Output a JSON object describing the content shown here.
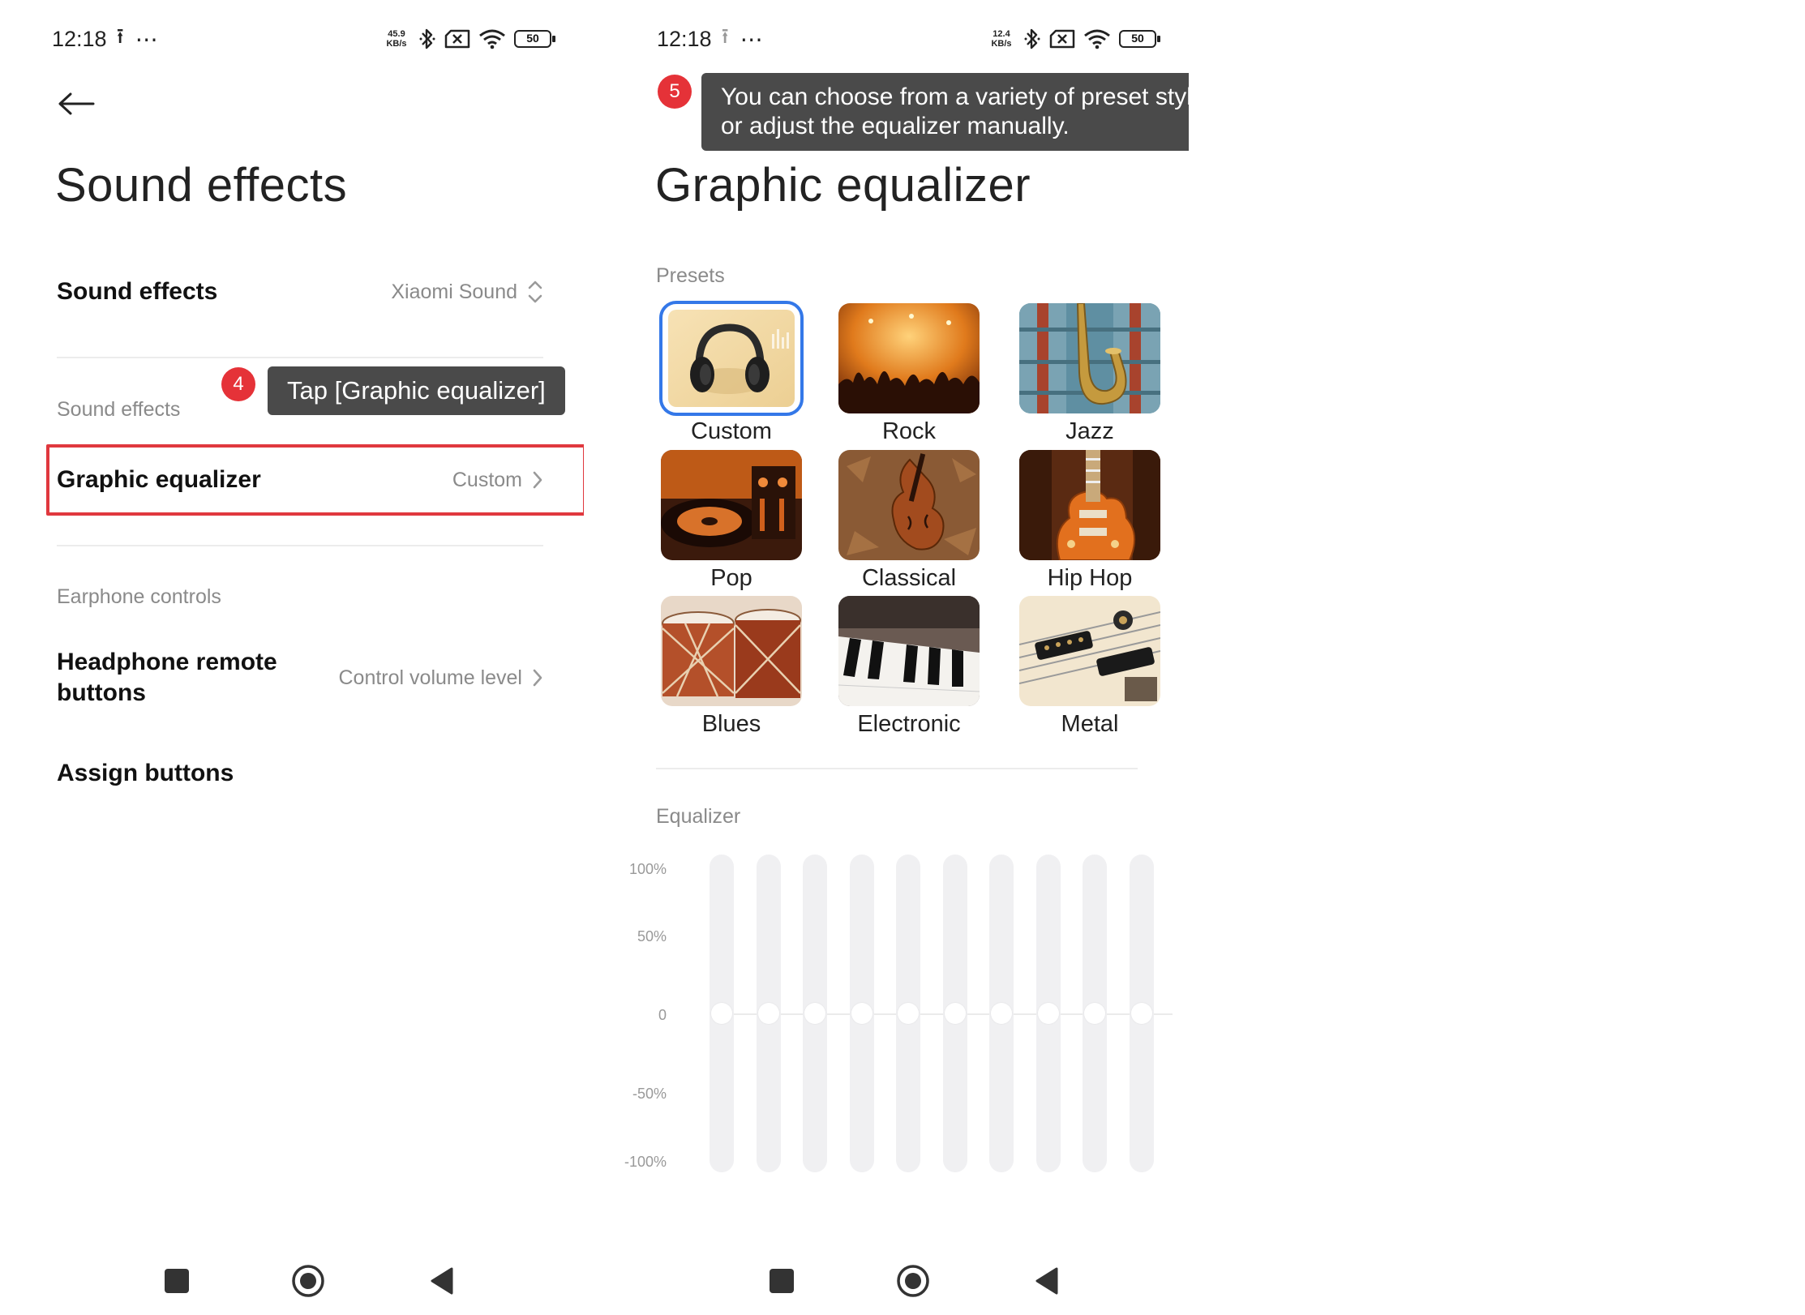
{
  "left": {
    "status": {
      "time": "12:18",
      "netspeed_value": "45.9",
      "netspeed_unit": "KB/s",
      "battery": "50"
    },
    "title": "Sound effects",
    "sound_effects_row": {
      "label": "Sound effects",
      "value": "Xiaomi Sound"
    },
    "section_sound_effects": "Sound effects",
    "graphic_eq_row": {
      "label": "Graphic equalizer",
      "value": "Custom"
    },
    "tip": {
      "step": "4",
      "text": "Tap [Graphic equalizer]"
    },
    "section_earphone": "Earphone controls",
    "headphone_row": {
      "label_line1": "Headphone remote",
      "label_line2": "buttons",
      "value": "Control volume level"
    },
    "assign_row": {
      "label": "Assign buttons"
    }
  },
  "right": {
    "status": {
      "time": "12:18",
      "netspeed_value": "12.4",
      "netspeed_unit": "KB/s",
      "battery": "50"
    },
    "tip": {
      "step": "5",
      "line1": "You can choose from a variety of preset styles",
      "line2": "or adjust the equalizer manually."
    },
    "title": "Graphic equalizer",
    "presets_label": "Presets",
    "presets": [
      {
        "label": "Custom",
        "selected": true
      },
      {
        "label": "Rock"
      },
      {
        "label": "Jazz"
      },
      {
        "label": "Pop"
      },
      {
        "label": "Classical"
      },
      {
        "label": "Hip Hop"
      },
      {
        "label": "Blues"
      },
      {
        "label": "Electronic"
      },
      {
        "label": "Metal"
      }
    ],
    "equalizer_label": "Equalizer",
    "eq_scale": [
      "100%",
      "50%",
      "0",
      "-50%",
      "-100%"
    ],
    "eq_band_levels": [
      0,
      0,
      0,
      0,
      0,
      0,
      0,
      0,
      0,
      0
    ]
  },
  "colors": {
    "accent_blue": "#3478e8",
    "highlight_red": "#e0383e",
    "badge_red": "#e53238",
    "tooltip_bg": "#4a4a4a"
  }
}
